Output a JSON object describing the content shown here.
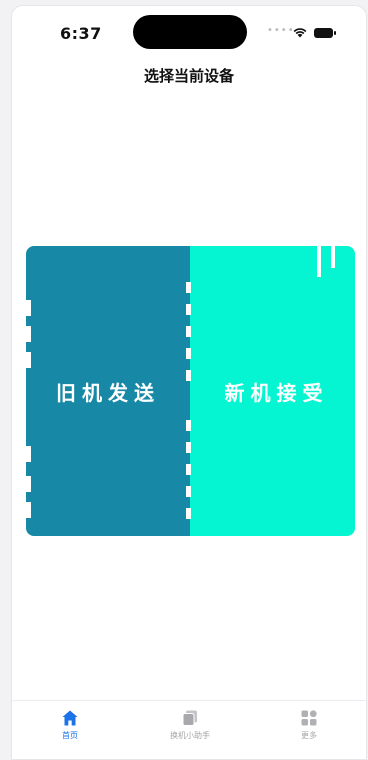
{
  "status_bar": {
    "time": "6:37",
    "signal_dots": "••••"
  },
  "header": {
    "title": "选择当前设备"
  },
  "options": [
    {
      "label": "旧机发送",
      "color": "#1789a7"
    },
    {
      "label": "新机接受",
      "color": "#05f5d2"
    }
  ],
  "tabbar": {
    "active_color": "#1a73e8",
    "tabs": [
      {
        "label": "首页",
        "icon": "home-icon",
        "active": true
      },
      {
        "label": "换机小助手",
        "icon": "phone-stack-icon",
        "active": false
      },
      {
        "label": "更多",
        "icon": "grid-icon",
        "active": false
      }
    ]
  }
}
